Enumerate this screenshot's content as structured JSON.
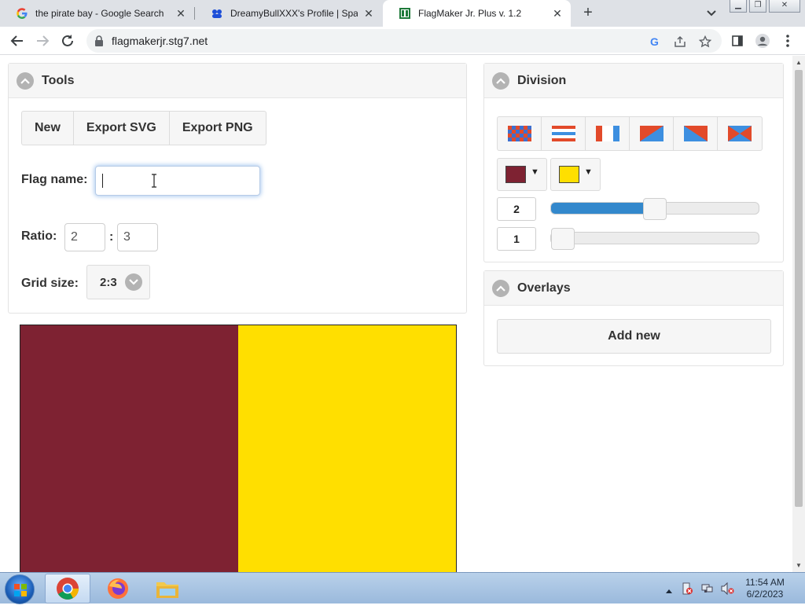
{
  "browser": {
    "tabs": [
      {
        "title": "the pirate bay - Google Search",
        "favicon": "google-icon",
        "active": false
      },
      {
        "title": "DreamyBullXXX's Profile | SpaceH",
        "favicon": "spacehey-icon",
        "active": false
      },
      {
        "title": "FlagMaker Jr. Plus v. 1.2",
        "favicon": "flagmaker-icon",
        "active": true
      }
    ],
    "url": "flagmakerjr.stg7.net"
  },
  "tools": {
    "title": "Tools",
    "buttons": {
      "new": "New",
      "export_svg": "Export SVG",
      "export_png": "Export PNG"
    },
    "flag_name_label": "Flag name:",
    "flag_name_value": "",
    "ratio_label": "Ratio:",
    "ratio_height": "2",
    "ratio_separator": ":",
    "ratio_width": "3",
    "grid_size_label": "Grid size:",
    "grid_size_value": "2:3"
  },
  "division": {
    "title": "Division",
    "types": [
      "checkered-division-icon",
      "horizontal-stripes-division-icon",
      "vertical-stripes-division-icon",
      "diagonal-up-division-icon",
      "diagonal-down-division-icon",
      "saltire-division-icon"
    ],
    "color1": "#7e2232",
    "color2": "#ffdf00",
    "count1": "2",
    "count1_fraction": 0.5,
    "count2": "1",
    "count2_fraction": 0.0
  },
  "overlays": {
    "title": "Overlays",
    "add_label": "Add new"
  },
  "flag": {
    "stripes": [
      "#7e2232",
      "#ffdf00"
    ]
  },
  "taskbar": {
    "time": "11:54 AM",
    "date": "6/2/2023"
  }
}
